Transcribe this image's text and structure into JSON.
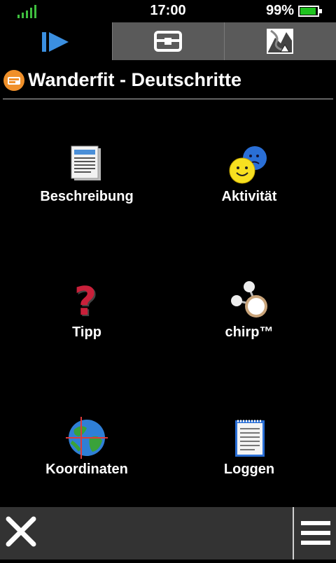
{
  "status_bar": {
    "time": "17:00",
    "battery_percent": "99%",
    "battery_level": 0.99,
    "signal_icon": "signal-bars-icon"
  },
  "tabs": [
    {
      "icon": "play-next-icon",
      "active": true
    },
    {
      "icon": "treasure-chest-icon",
      "active": false
    },
    {
      "icon": "map-route-icon",
      "active": false
    }
  ],
  "cache": {
    "title": "Wanderfit - Deutschritte",
    "logo_icon": "geocache-logo-icon"
  },
  "menu_items": [
    {
      "label": "Beschreibung",
      "icon": "document-icon"
    },
    {
      "label": "Aktivität",
      "icon": "smiley-faces-icon"
    },
    {
      "label": "Tipp",
      "icon": "question-mark-icon"
    },
    {
      "label": "chirp™",
      "icon": "chirp-icon"
    },
    {
      "label": "Koordinaten",
      "icon": "globe-crosshair-icon"
    },
    {
      "label": "Loggen",
      "icon": "notepad-icon"
    }
  ],
  "bottom_bar": {
    "close_icon": "close-icon",
    "menu_icon": "hamburger-menu-icon"
  }
}
